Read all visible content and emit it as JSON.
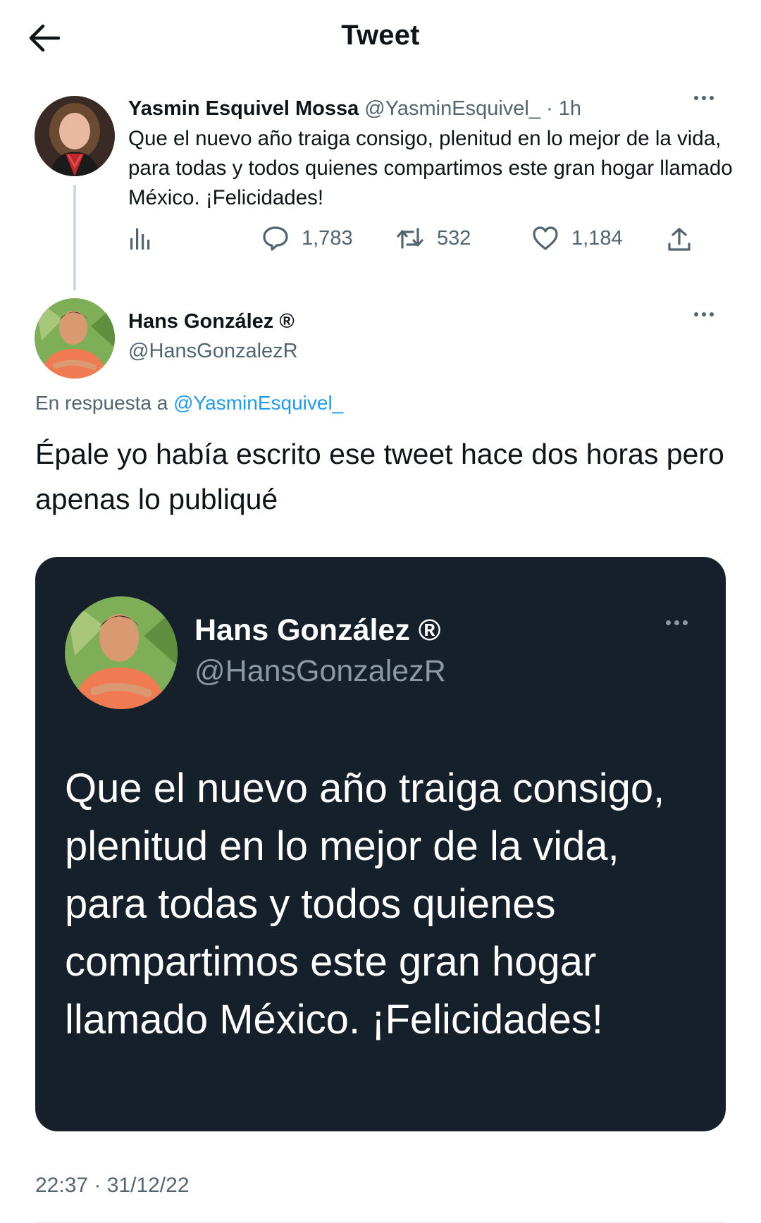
{
  "header": {
    "title": "Tweet"
  },
  "tweet1": {
    "author_name": "Yasmin Esquivel Mossa",
    "handle": "@YasminEsquivel_",
    "time": "· 1h",
    "text": "Que el nuevo año traiga consigo, plenitud en lo mejor de la vida, para todas y todos quienes compartimos este gran hogar llamado México. ¡Felicidades!",
    "actions": {
      "reply_count": "1,783",
      "retweet_count": "532",
      "like_count": "1,184"
    }
  },
  "tweet2": {
    "author_name": "Hans González ®",
    "handle": "@HansGonzalezR",
    "reply_prefix": "En respuesta a",
    "reply_to": "@YasminEsquivel_",
    "text": "Épale yo había escrito ese tweet hace dos horas pero apenas lo publiqué",
    "timestamp": "22:37 · 31/12/22"
  },
  "embedded_card": {
    "author_name": "Hans González ®",
    "handle": "@HansGonzalezR",
    "text": "Que el nuevo año traiga consigo, plenitud en lo mejor de la vida, para todas y todos quienes compartimos este gran hogar llamado México. ¡Felicidades!"
  },
  "colors": {
    "accent": "#1d9bf0",
    "muted": "#536471",
    "card_background": "#15202b"
  },
  "icons": [
    "back-arrow-icon",
    "more-icon",
    "analytics-icon",
    "reply-icon",
    "retweet-icon",
    "like-icon",
    "share-icon"
  ]
}
